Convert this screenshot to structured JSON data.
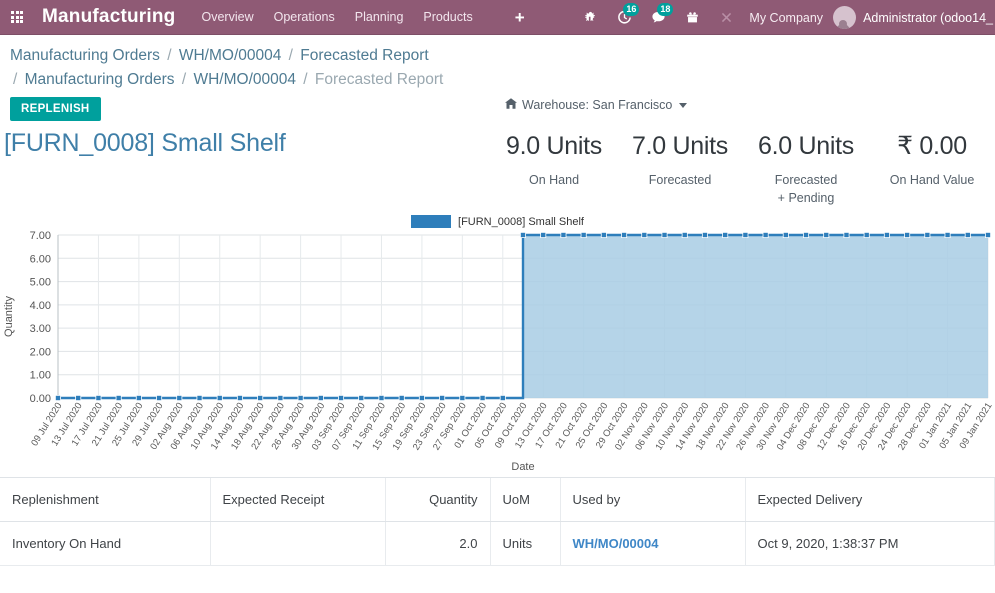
{
  "navbar": {
    "apps_icon": "apps-grid-icon",
    "brand": "Manufacturing",
    "menu": [
      {
        "label": "Overview"
      },
      {
        "label": "Operations"
      },
      {
        "label": "Planning"
      },
      {
        "label": "Products"
      }
    ],
    "plus_label": "+",
    "icons": [
      {
        "name": "bug-icon",
        "badge": ""
      },
      {
        "name": "activity-clock-icon",
        "badge": "16"
      },
      {
        "name": "messaging-chat-icon",
        "badge": "18"
      },
      {
        "name": "gift-icon",
        "badge": ""
      },
      {
        "name": "close-x-icon",
        "badge": ""
      }
    ],
    "company": "My Company",
    "user": "Administrator (odoo14_",
    "bg_color": "#8f5a75",
    "badge_color": "#00a09d"
  },
  "breadcrumb": {
    "line1": [
      {
        "label": "Manufacturing Orders",
        "current": false
      },
      {
        "label": "WH/MO/00004",
        "current": false
      },
      {
        "label": "Forecasted Report",
        "current": false
      }
    ],
    "line2": [
      {
        "label": "Manufacturing Orders",
        "current": false
      },
      {
        "label": "WH/MO/00004",
        "current": false
      },
      {
        "label": "Forecasted Report",
        "current": true
      }
    ],
    "separator": "/"
  },
  "actions": {
    "replenish_label": "REPLENISH",
    "replenish_color": "#00a09d",
    "warehouse_icon": "warehouse-home-icon",
    "warehouse_label": "Warehouse: San Francisco"
  },
  "product": {
    "title": "[FURN_0008] Small Shelf",
    "title_color": "#3f7fa8"
  },
  "kpis": [
    {
      "value": "9.0 Units",
      "label": "On Hand"
    },
    {
      "value": "7.0 Units",
      "label": "Forecasted"
    },
    {
      "value": "6.0 Units",
      "label": "Forecasted\n+ Pending"
    },
    {
      "value": "₹ 0.00",
      "label": "On Hand Value"
    }
  ],
  "chart_data": {
    "type": "area",
    "title": "",
    "legend": [
      "[FURN_0008] Small Shelf"
    ],
    "legend_position": "top-center",
    "legend_color": "#2e7ebb",
    "line_color": "#2e7ebb",
    "fill_color": "#a8cce4",
    "xlabel": "Date",
    "ylabel": "Quantity",
    "ylim": [
      0,
      7
    ],
    "yticks": [
      "0.00",
      "1.00",
      "2.00",
      "3.00",
      "4.00",
      "5.00",
      "6.00",
      "7.00"
    ],
    "grid": true,
    "x": [
      "09 Jul 2020",
      "13 Jul 2020",
      "17 Jul 2020",
      "21 Jul 2020",
      "25 Jul 2020",
      "29 Jul 2020",
      "02 Aug 2020",
      "06 Aug 2020",
      "10 Aug 2020",
      "14 Aug 2020",
      "18 Aug 2020",
      "22 Aug 2020",
      "26 Aug 2020",
      "30 Aug 2020",
      "03 Sep 2020",
      "07 Sep 2020",
      "11 Sep 2020",
      "15 Sep 2020",
      "19 Sep 2020",
      "23 Sep 2020",
      "27 Sep 2020",
      "01 Oct 2020",
      "05 Oct 2020",
      "09 Oct 2020",
      "13 Oct 2020",
      "17 Oct 2020",
      "21 Oct 2020",
      "25 Oct 2020",
      "29 Oct 2020",
      "02 Nov 2020",
      "06 Nov 2020",
      "10 Nov 2020",
      "14 Nov 2020",
      "18 Nov 2020",
      "22 Nov 2020",
      "26 Nov 2020",
      "30 Nov 2020",
      "04 Dec 2020",
      "08 Dec 2020",
      "12 Dec 2020",
      "16 Dec 2020",
      "20 Dec 2020",
      "24 Dec 2020",
      "28 Dec 2020",
      "01 Jan 2021",
      "05 Jan 2021",
      "09 Jan 2021"
    ],
    "series": [
      {
        "name": "[FURN_0008] Small Shelf",
        "values": [
          0,
          0,
          0,
          0,
          0,
          0,
          0,
          0,
          0,
          0,
          0,
          0,
          0,
          0,
          0,
          0,
          0,
          0,
          0,
          0,
          0,
          0,
          0,
          7,
          7,
          7,
          7,
          7,
          7,
          7,
          7,
          7,
          7,
          7,
          7,
          7,
          7,
          7,
          7,
          7,
          7,
          7,
          7,
          7,
          7,
          7,
          7
        ]
      }
    ],
    "step_date": "09 Oct 2020",
    "step_from": 0,
    "step_to": 7
  },
  "table": {
    "columns": [
      {
        "key": "replenishment",
        "label": "Replenishment",
        "align": "left"
      },
      {
        "key": "expected_receipt",
        "label": "Expected Receipt",
        "align": "left"
      },
      {
        "key": "quantity",
        "label": "Quantity",
        "align": "right"
      },
      {
        "key": "uom",
        "label": "UoM",
        "align": "left"
      },
      {
        "key": "used_by",
        "label": "Used by",
        "align": "left"
      },
      {
        "key": "expected_delivery",
        "label": "Expected Delivery",
        "align": "left"
      }
    ],
    "rows": [
      {
        "replenishment": "Inventory On Hand",
        "expected_receipt": "",
        "quantity": "2.0",
        "uom": "Units",
        "used_by": "WH/MO/00004",
        "used_by_is_link": true,
        "expected_delivery": "Oct 9, 2020, 1:38:37 PM"
      }
    ]
  }
}
